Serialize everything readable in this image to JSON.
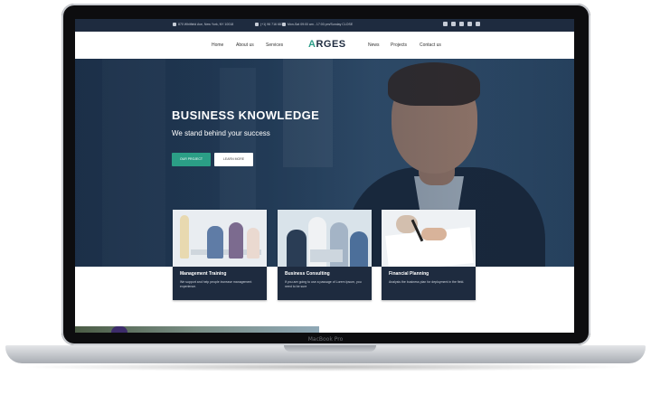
{
  "device": {
    "brand_label": "MacBook Pro"
  },
  "topbar": {
    "address": "870 Whitfield Ave, New York, NY 10018",
    "phone": "(+1) 96 716 6879",
    "hours": "Mon-Sat 09:00 am - 17:00 pm/Sunday CLOSE",
    "social_icons": [
      "facebook-icon",
      "twitter-icon",
      "google-plus-icon",
      "pinterest-icon",
      "linkedin-icon"
    ]
  },
  "nav": {
    "logo": "ARGES",
    "left_links": [
      "Home",
      "About us",
      "Services"
    ],
    "right_links": [
      "News",
      "Projects",
      "Contact us"
    ]
  },
  "hero": {
    "title": "BUSINESS KNOWLEDGE",
    "subtitle": "We stand behind your success",
    "primary_button": "OUR PROJECT",
    "secondary_button": "LEARN MORE"
  },
  "cards": [
    {
      "title": "Management Training",
      "text": "We support and help people increase management experience."
    },
    {
      "title": "Business Consulting",
      "text": "If you are going to use a passage of Lorem Ipsum, you need to be sure"
    },
    {
      "title": "Financial Planning",
      "text": "Analysis the business plan for deployment in the field."
    }
  ],
  "colors": {
    "navy": "#1e2b3f",
    "accent": "#2b9e86",
    "white": "#ffffff"
  }
}
